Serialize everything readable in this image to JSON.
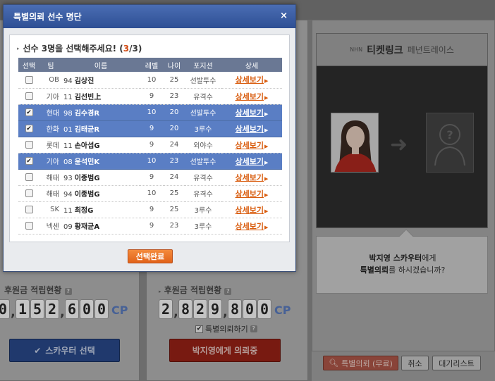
{
  "modal": {
    "title": "특별의뢰 선수 명단",
    "close_glyph": "×",
    "prompt_text": "선수 3명을 선택해주세요! (",
    "prompt_selected": "3",
    "prompt_total": "/3)",
    "headers": [
      "선택",
      "팀",
      "이름",
      "레벨",
      "나이",
      "포지션",
      "상세"
    ],
    "detail_label": "상세보기",
    "rows": [
      {
        "checked": false,
        "team": "OB",
        "num": "94",
        "name": "김상진",
        "level": "10",
        "age": "25",
        "position": "선발투수"
      },
      {
        "checked": false,
        "team": "기아",
        "num": "11",
        "name": "김선빈上",
        "level": "9",
        "age": "23",
        "position": "유격수"
      },
      {
        "checked": true,
        "team": "현대",
        "num": "98",
        "name": "김수경R",
        "level": "10",
        "age": "20",
        "position": "선발투수"
      },
      {
        "checked": true,
        "team": "한화",
        "num": "01",
        "name": "김태균R",
        "level": "9",
        "age": "20",
        "position": "3루수"
      },
      {
        "checked": false,
        "team": "롯데",
        "num": "11",
        "name": "손아섭G",
        "level": "9",
        "age": "24",
        "position": "외야수"
      },
      {
        "checked": true,
        "team": "기아",
        "num": "08",
        "name": "윤석민K",
        "level": "10",
        "age": "23",
        "position": "선발투수"
      },
      {
        "checked": false,
        "team": "해태",
        "num": "93",
        "name": "이종범G",
        "level": "9",
        "age": "24",
        "position": "유격수"
      },
      {
        "checked": false,
        "team": "해태",
        "num": "94",
        "name": "이종범G",
        "level": "10",
        "age": "25",
        "position": "유격수"
      },
      {
        "checked": false,
        "team": "SK",
        "num": "11",
        "name": "최정G",
        "level": "9",
        "age": "25",
        "position": "3루수"
      },
      {
        "checked": false,
        "team": "넥센",
        "num": "09",
        "name": "황재균A",
        "level": "9",
        "age": "23",
        "position": "3루수"
      }
    ],
    "done_label": "선택완료"
  },
  "left_panel": {
    "fund_label": "후원금 적립현황",
    "digits": [
      "0",
      ",",
      "1",
      "5",
      "2",
      ",",
      "6",
      "0",
      "0"
    ],
    "unit": "CP",
    "scout_button": "스카우터 선택"
  },
  "middle_panel": {
    "fund_label": "후원금 적립현황",
    "digits": [
      "2",
      ",",
      "8",
      "2",
      "9",
      ",",
      "8",
      "0",
      "0"
    ],
    "unit": "CP",
    "checkbox_label": "특별의뢰하기",
    "request_button": "박지영에게 의뢰중"
  },
  "right_panel": {
    "brand_small": "NHN",
    "brand": "티켓링크",
    "tagline": "페넌트레이스",
    "scouter_name": "박지영 스카우터",
    "msg_suffix": "에게",
    "msg_line2_bold": "특별의뢰",
    "msg_line2_rest": "를 하시겠습니까?",
    "unknown_mark": "?",
    "btn_request": "특별의뢰 (무료)",
    "btn_cancel": "취소",
    "btn_waitlist": "대기리스트"
  },
  "icons": {
    "checkmark": "check-icon",
    "search": "search-icon",
    "help": "help-icon",
    "arrow": "arrow-right-icon"
  },
  "colors": {
    "modal_title": "#3a5da3",
    "selected_row": "#5a7ec4",
    "detail_link": "#d95d0f",
    "done_button": "#ea6f22"
  }
}
